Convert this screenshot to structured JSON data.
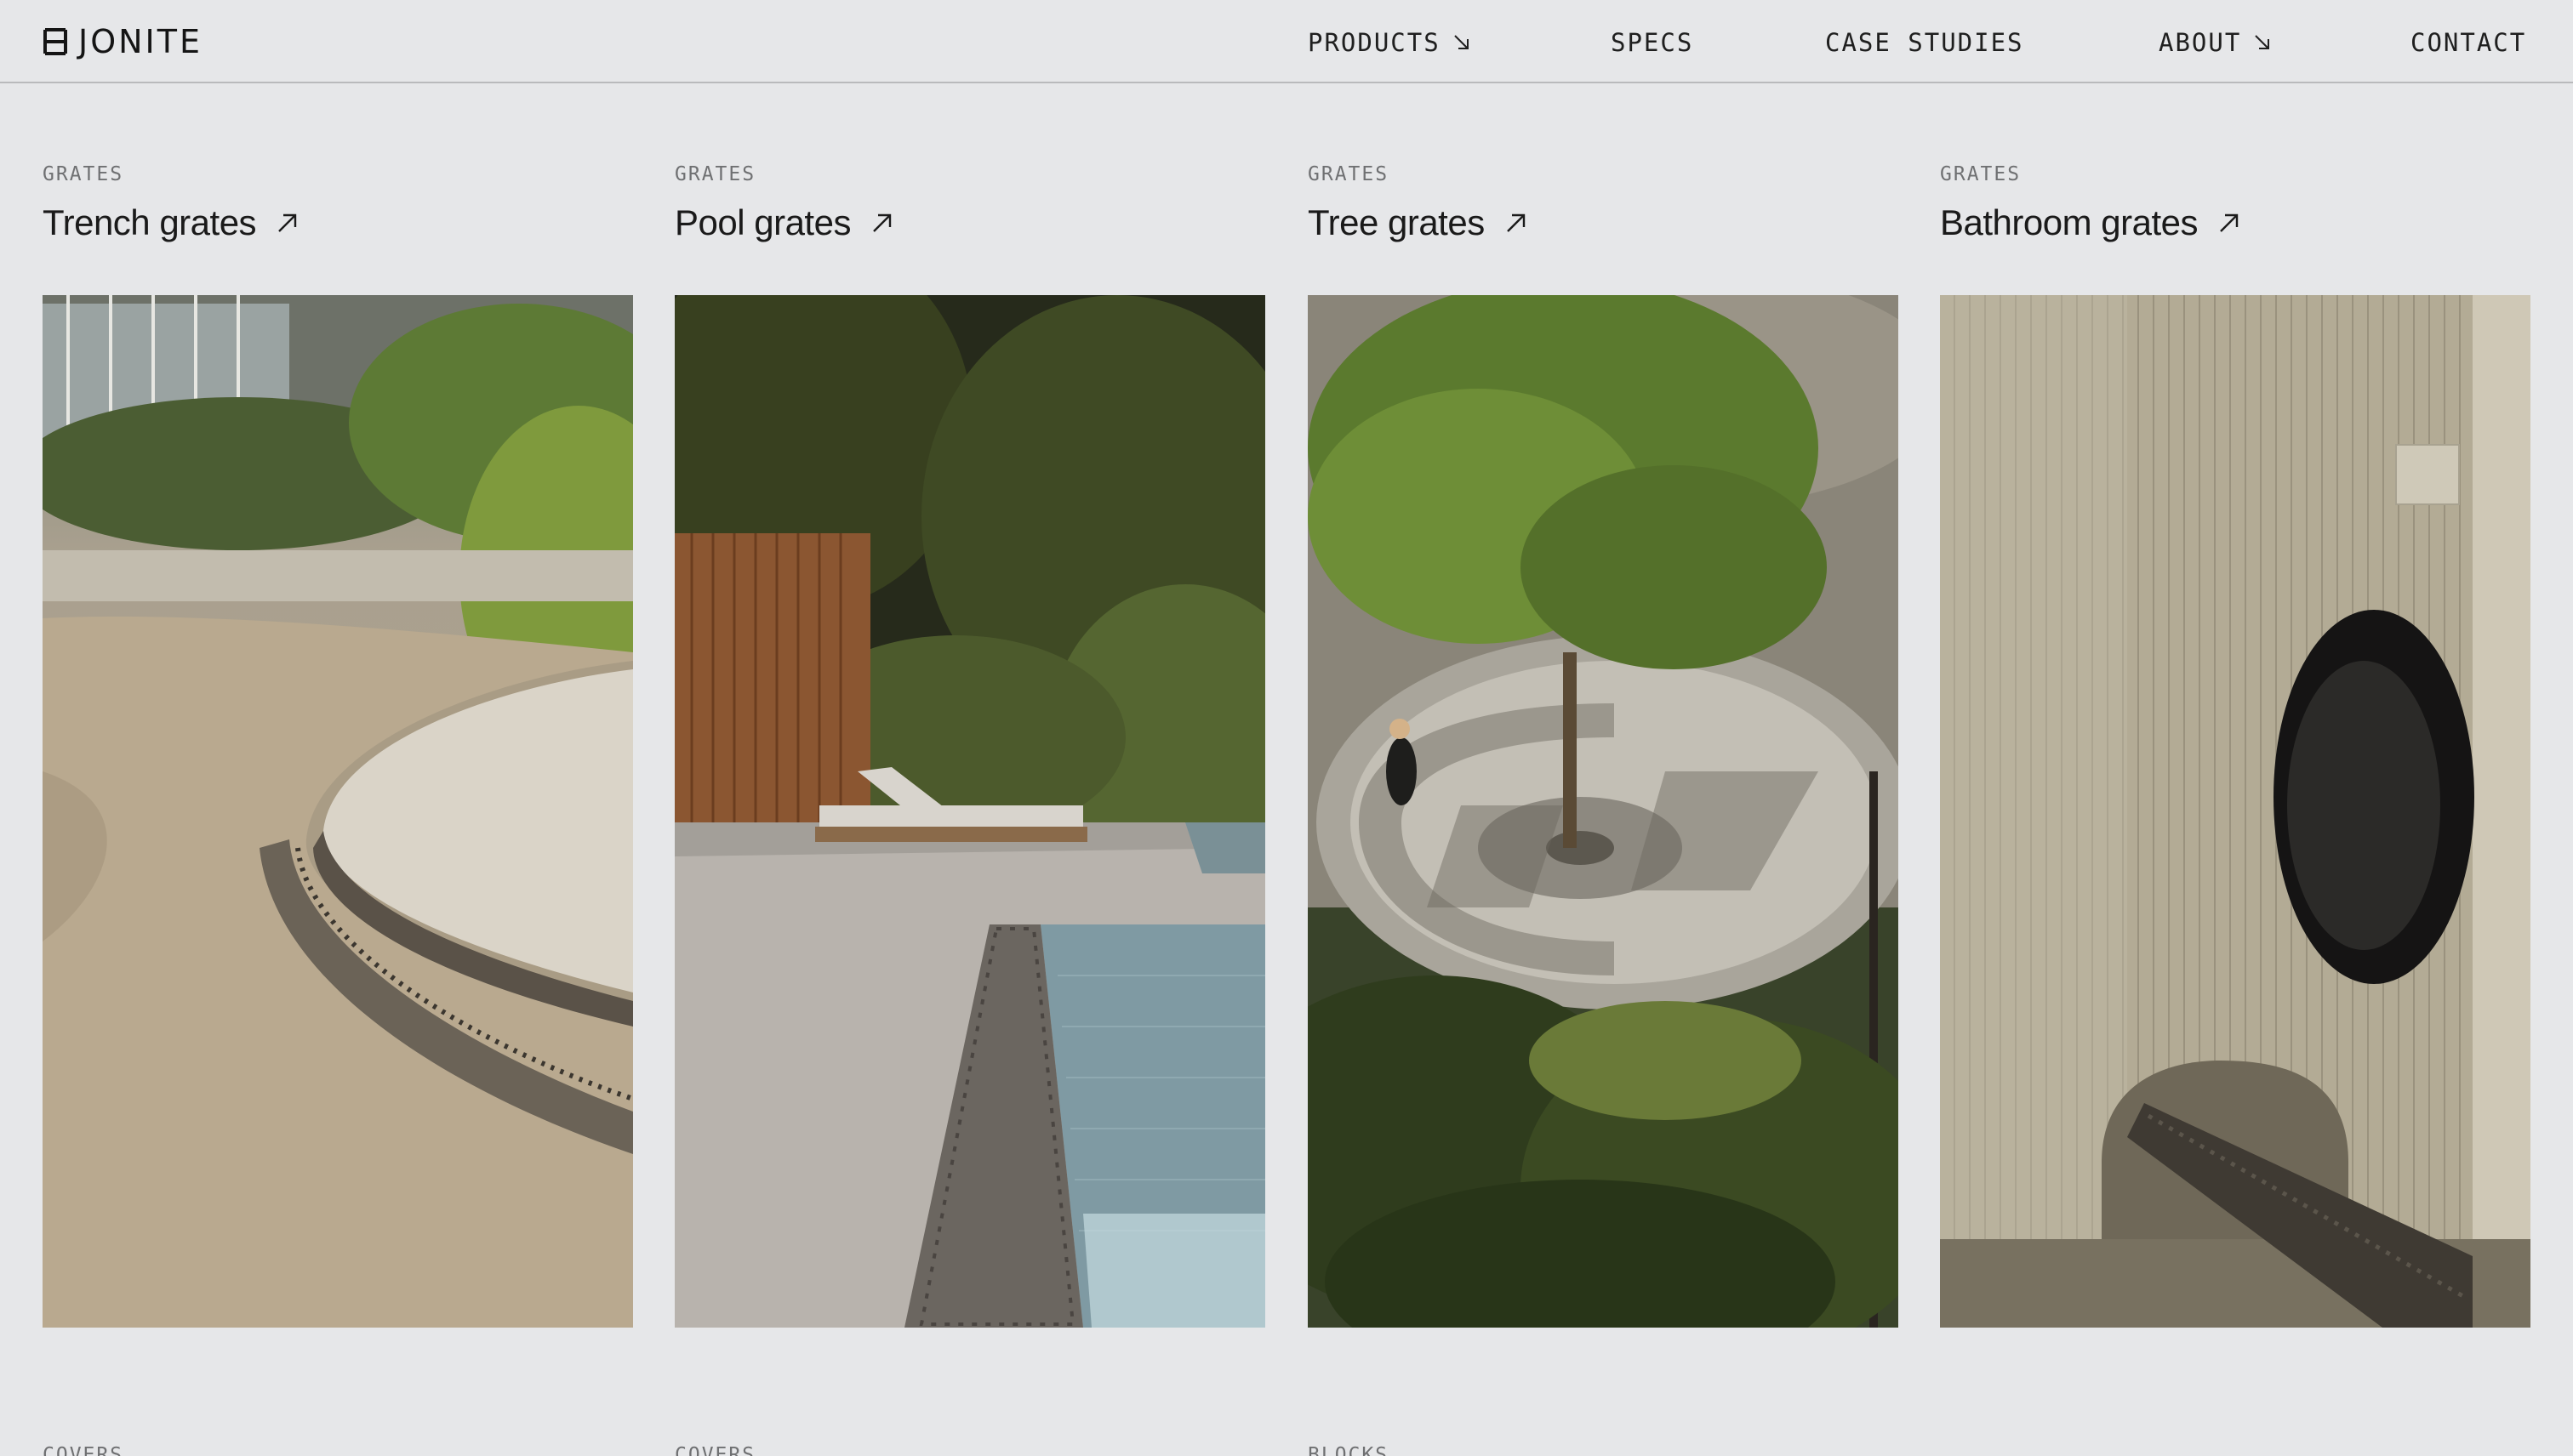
{
  "header": {
    "brand": "JONITE",
    "nav": [
      {
        "label": "PRODUCTS",
        "icon": "arrow-down-right-icon"
      },
      {
        "label": "SPECS"
      },
      {
        "label": "CASE STUDIES"
      },
      {
        "label": "ABOUT",
        "icon": "arrow-down-right-icon"
      },
      {
        "label": "CONTACT"
      }
    ]
  },
  "cards": [
    {
      "category": "GRATES",
      "title": "Trench grates",
      "icon": "arrow-up-right-icon",
      "image": "trench-grate-plaza-photo"
    },
    {
      "category": "GRATES",
      "title": "Pool grates",
      "icon": "arrow-up-right-icon",
      "image": "pool-grate-photo"
    },
    {
      "category": "GRATES",
      "title": "Tree grates",
      "icon": "arrow-up-right-icon",
      "image": "tree-grate-courtyard-photo"
    },
    {
      "category": "GRATES",
      "title": "Bathroom grates",
      "icon": "arrow-up-right-icon",
      "image": "bathroom-grate-photo"
    }
  ],
  "next_row": [
    {
      "category": "COVERS"
    },
    {
      "category": "COVERS"
    },
    {
      "category": "BLOCKS"
    }
  ],
  "colors": {
    "background": "#e6e7e9",
    "text": "#1b1b1b",
    "muted": "#6f7072"
  }
}
